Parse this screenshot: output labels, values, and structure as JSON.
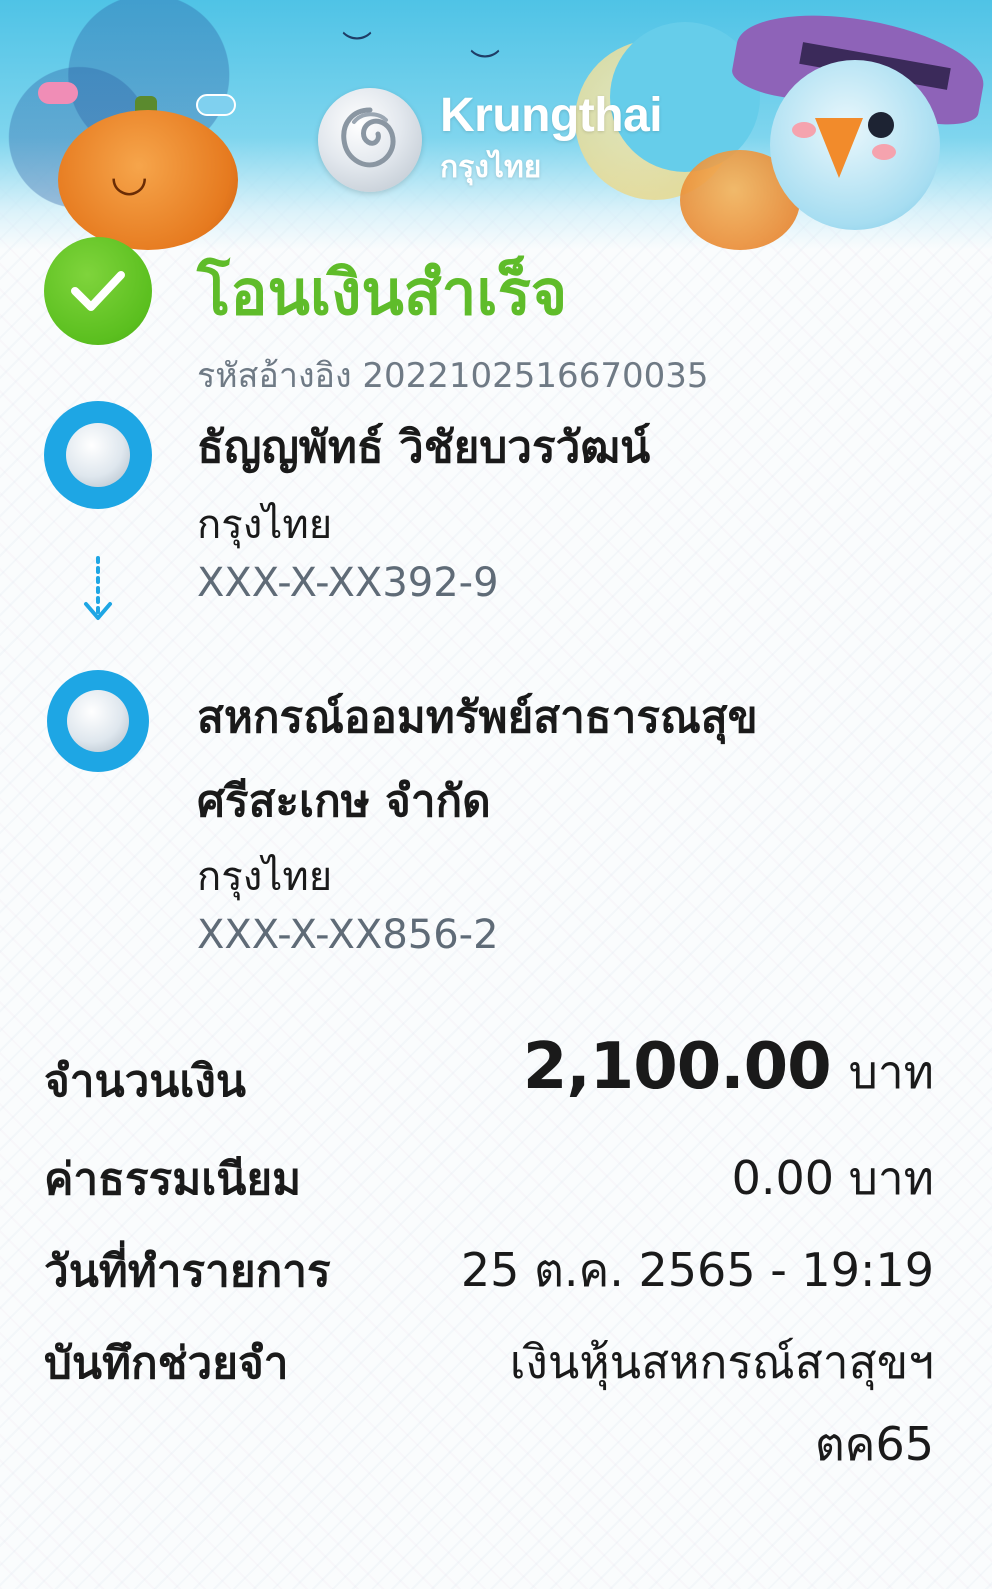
{
  "brand": {
    "name_en": "Krungthai",
    "name_th": "กรุงไทย"
  },
  "status": {
    "title": "โอนเงินสำเร็จ",
    "ref_label": "รหัสอ้างอิง",
    "ref_number": "2022102516670035",
    "icon": "check-circle-icon",
    "color": "#5fbc2a"
  },
  "sender": {
    "name": "ธัญญพัทธ์ วิชัยบวรวัฒน์",
    "bank": "กรุงไทย",
    "account": "XXX-X-XX392-9",
    "icon": "krungthai-logo-icon"
  },
  "receiver": {
    "name_line1": "สหกรณ์ออมทรัพย์สาธารณสุข",
    "name_line2": "ศรีสะเกษ จำกัด",
    "bank": "กรุงไทย",
    "account": "XXX-X-XX856-2",
    "icon": "krungthai-logo-icon"
  },
  "details": {
    "amount_label": "จำนวนเงิน",
    "amount_value": "2,100.00",
    "amount_unit": "บาท",
    "fee_label": "ค่าธรรมเนียม",
    "fee_value": "0.00 บาท",
    "date_label": "วันที่ทำรายการ",
    "date_value": "25 ต.ค. 2565 - 19:19",
    "memo_label": "บันทึกช่วยจำ",
    "memo_line1": "เงินหุ้นสหกรณ์สาสุขฯ",
    "memo_line2": "ตค65"
  },
  "colors": {
    "accent_blue": "#1ea6e4",
    "success_green": "#5fbc2a",
    "muted_text": "#6f7a85"
  }
}
